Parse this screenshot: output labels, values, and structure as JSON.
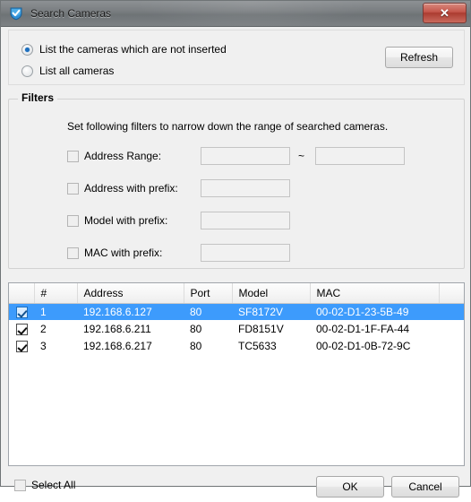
{
  "window": {
    "title": "Search Cameras",
    "app_icon": "shield-check-icon",
    "close_label": "✕"
  },
  "mode": {
    "options": [
      {
        "label": "List the cameras which are not inserted",
        "selected": true
      },
      {
        "label": "List all cameras",
        "selected": false
      }
    ],
    "refresh_label": "Refresh"
  },
  "filters": {
    "legend": "Filters",
    "description": "Set following filters to narrow down the range of searched cameras.",
    "separator": "~",
    "rows": [
      {
        "label": "Address Range:",
        "checked": false,
        "enabled": false,
        "value": "",
        "value2": ""
      },
      {
        "label": "Address with prefix:",
        "checked": false,
        "enabled": false,
        "value": ""
      },
      {
        "label": "Model with prefix:",
        "checked": false,
        "enabled": false,
        "value": ""
      },
      {
        "label": "MAC with prefix:",
        "checked": false,
        "enabled": false,
        "value": ""
      }
    ]
  },
  "table": {
    "columns": [
      "",
      "#",
      "Address",
      "Port",
      "Model",
      "MAC",
      ""
    ],
    "rows": [
      {
        "checked": true,
        "num": "1",
        "address": "192.168.6.127",
        "port": "80",
        "model": "SF8172V",
        "mac": "00-02-D1-23-5B-49",
        "selected": true
      },
      {
        "checked": true,
        "num": "2",
        "address": "192.168.6.211",
        "port": "80",
        "model": "FD8151V",
        "mac": "00-02-D1-1F-FA-44",
        "selected": false
      },
      {
        "checked": true,
        "num": "3",
        "address": "192.168.6.217",
        "port": "80",
        "model": "TC5633",
        "mac": "00-02-D1-0B-72-9C",
        "selected": false
      }
    ]
  },
  "footer": {
    "select_all_label": "Select All",
    "select_all_checked": false,
    "ok_label": "OK",
    "cancel_label": "Cancel"
  },
  "colors": {
    "selection_blue": "#3d9bfc",
    "close_red": "#c4554a",
    "radio_blue": "#1d6fbe",
    "window_bg": "#f0f0f0"
  }
}
